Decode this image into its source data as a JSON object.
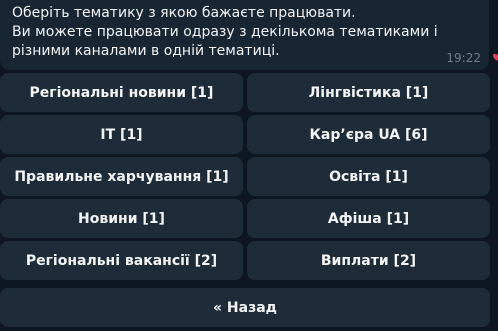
{
  "message": {
    "lines": [
      "Оберіть тематику з якою бажаєте працювати.",
      "Ви можете працювати одразу з декількома тематиками і",
      "різними каналами в одній тематиці."
    ],
    "time": "19:22"
  },
  "keyboard": {
    "rows": [
      [
        "Регіональні новини [1]",
        "Лінгвістика [1]"
      ],
      [
        "IT [1]",
        "Кар’єра UA [6]"
      ],
      [
        "Правильне харчування [1]",
        "Освіта [1]"
      ],
      [
        "Новини [1]",
        "Афіша [1]"
      ],
      [
        "Регіональні вакансії [2]",
        "Виплати [2]"
      ]
    ],
    "back_label": "« Назад"
  },
  "colors": {
    "background": "#0e1621",
    "bubble": "#182533",
    "button": "#1e2c3a",
    "text": "#f5f5f5",
    "time": "#6d7f8f",
    "reaction": "#e0425a"
  },
  "icons": {
    "reaction": "heart-icon"
  }
}
